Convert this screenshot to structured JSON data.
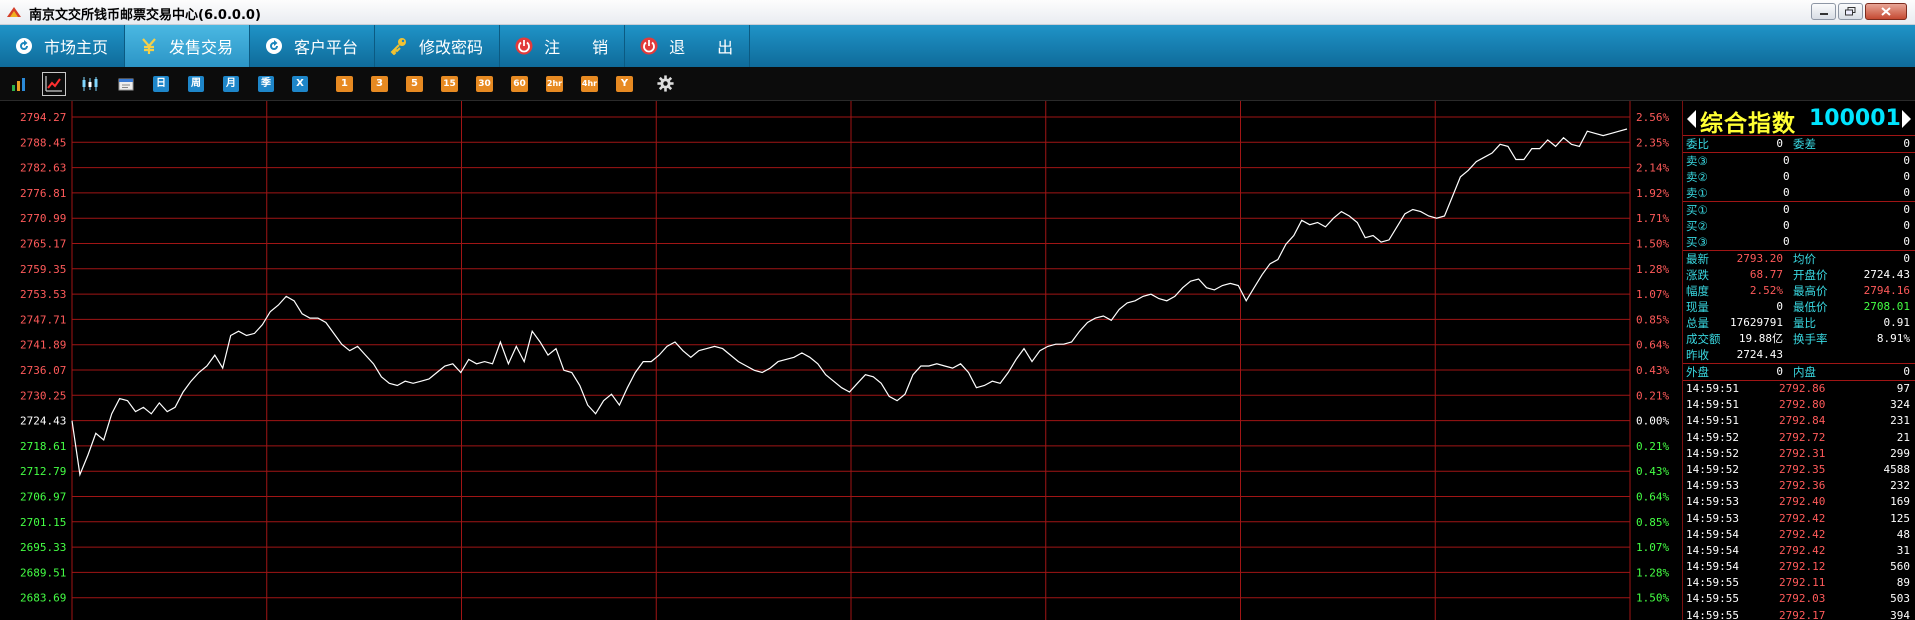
{
  "window": {
    "title": "南京文交所钱币邮票交易中心(6.0.0.0)"
  },
  "menu": [
    {
      "label": "市场主页",
      "icon": "refresh-icon",
      "active": false
    },
    {
      "label": "发售交易",
      "icon": "yen-icon",
      "active": true
    },
    {
      "label": "客户平台",
      "icon": "refresh-icon",
      "active": false
    },
    {
      "label": "修改密码",
      "icon": "key-icon",
      "active": false
    },
    {
      "label": "注　　销",
      "icon": "power-icon",
      "active": false
    },
    {
      "label": "退　　出",
      "icon": "power-icon",
      "active": false
    }
  ],
  "toolbar": {
    "blue_buttons": [
      "日",
      "周",
      "月",
      "季",
      "X"
    ],
    "orange_buttons": [
      "1",
      "3",
      "5",
      "15",
      "30",
      "60",
      "2hr",
      "4hr",
      "Y"
    ]
  },
  "chart_data": {
    "type": "line",
    "y_left_ticks": [
      "2794.27",
      "2788.45",
      "2782.63",
      "2776.81",
      "2770.99",
      "2765.17",
      "2759.35",
      "2753.53",
      "2747.71",
      "2741.89",
      "2736.07",
      "2730.25",
      "2724.43",
      "2718.61",
      "2712.79",
      "2706.97",
      "2701.15",
      "2695.33",
      "2689.51",
      "2683.69"
    ],
    "y_right_ticks": [
      "2.56%",
      "2.35%",
      "2.14%",
      "1.92%",
      "1.71%",
      "1.50%",
      "1.28%",
      "1.07%",
      "0.85%",
      "0.64%",
      "0.43%",
      "0.21%",
      "0.00%",
      "0.21%",
      "0.43%",
      "0.64%",
      "0.85%",
      "1.07%",
      "1.28%",
      "1.50%"
    ],
    "ylim": [
      2683.69,
      2794.27
    ],
    "base": 2724.43,
    "colors": {
      "up": "#ff5a5a",
      "down": "#44ff44",
      "flat": "#ffffff",
      "grid": "#a01515",
      "line": "#ffffff"
    },
    "series": [
      {
        "values": [
          2724.4,
          2712.0,
          2716.5,
          2721.5,
          2720.0,
          2726.0,
          2729.5,
          2729.0,
          2726.5,
          2727.5,
          2726.0,
          2728.5,
          2726.5,
          2727.5,
          2731.0,
          2733.5,
          2735.5,
          2737.0,
          2739.5,
          2736.5,
          2744.0,
          2745.0,
          2744.0,
          2744.5,
          2746.5,
          2749.5,
          2751.0,
          2753.0,
          2752.0,
          2749.0,
          2748.0,
          2748.0,
          2747.0,
          2744.5,
          2742.0,
          2740.5,
          2741.5,
          2739.5,
          2737.5,
          2734.5,
          2733.0,
          2732.5,
          2733.5,
          2733.0,
          2733.5,
          2734.0,
          2735.5,
          2737.0,
          2737.5,
          2735.5,
          2738.5,
          2737.5,
          2738.0,
          2737.5,
          2742.5,
          2737.5,
          2741.5,
          2738.0,
          2745.0,
          2742.5,
          2739.5,
          2741.0,
          2736.0,
          2735.5,
          2732.5,
          2728.0,
          2726.0,
          2729.0,
          2730.5,
          2728.0,
          2732.0,
          2735.5,
          2738.0,
          2738.0,
          2739.5,
          2741.5,
          2742.5,
          2740.5,
          2739.0,
          2740.5,
          2741.0,
          2741.5,
          2741.0,
          2739.5,
          2738.0,
          2737.0,
          2736.0,
          2735.5,
          2736.5,
          2738.0,
          2738.5,
          2739.0,
          2740.0,
          2739.0,
          2737.5,
          2735.0,
          2733.5,
          2732.0,
          2731.0,
          2733.0,
          2735.0,
          2734.5,
          2733.0,
          2730.0,
          2729.0,
          2730.5,
          2735.0,
          2737.0,
          2737.0,
          2737.5,
          2737.0,
          2736.5,
          2737.5,
          2735.5,
          2732.0,
          2732.5,
          2733.5,
          2733.0,
          2735.5,
          2738.5,
          2741.0,
          2738.0,
          2740.5,
          2741.5,
          2742.0,
          2742.0,
          2742.5,
          2745.0,
          2747.0,
          2748.0,
          2748.5,
          2747.5,
          2750.0,
          2751.5,
          2752.0,
          2753.0,
          2753.5,
          2752.5,
          2752.0,
          2753.0,
          2755.0,
          2756.5,
          2757.0,
          2755.0,
          2754.5,
          2755.5,
          2756.0,
          2755.5,
          2752.0,
          2755.0,
          2758.0,
          2760.5,
          2761.5,
          2765.0,
          2767.0,
          2770.5,
          2769.5,
          2770.0,
          2769.0,
          2771.0,
          2772.5,
          2771.5,
          2770.0,
          2766.5,
          2767.0,
          2765.5,
          2766.0,
          2769.0,
          2772.0,
          2773.0,
          2772.5,
          2771.5,
          2771.0,
          2771.5,
          2776.0,
          2780.5,
          2782.0,
          2784.0,
          2785.0,
          2786.0,
          2788.0,
          2787.5,
          2784.5,
          2784.5,
          2787.0,
          2787.0,
          2789.0,
          2787.5,
          2789.5,
          2788.0,
          2787.5,
          2791.0,
          2790.5,
          2790.0,
          2790.5,
          2791.0,
          2791.5
        ]
      }
    ]
  },
  "quote": {
    "name": "综合指数",
    "code": "100001",
    "top": [
      {
        "label": "委比",
        "value": "0",
        "label2": "委差",
        "value2": "0"
      }
    ],
    "sell": [
      {
        "label": "卖③",
        "price": "0",
        "vol": "0"
      },
      {
        "label": "卖②",
        "price": "0",
        "vol": "0"
      },
      {
        "label": "卖①",
        "price": "0",
        "vol": "0"
      }
    ],
    "buy": [
      {
        "label": "买①",
        "price": "0",
        "vol": "0"
      },
      {
        "label": "买②",
        "price": "0",
        "vol": "0"
      },
      {
        "label": "买③",
        "price": "0",
        "vol": "0"
      }
    ],
    "stats": [
      {
        "label": "最新",
        "value": "2793.20",
        "c1": "red",
        "label2": "均价",
        "value2": "0",
        "c2": "white"
      },
      {
        "label": "涨跌",
        "value": "68.77",
        "c1": "red",
        "label2": "开盘价",
        "value2": "2724.43",
        "c2": "white"
      },
      {
        "label": "幅度",
        "value": "2.52%",
        "c1": "red",
        "label2": "最高价",
        "value2": "2794.16",
        "c2": "red"
      },
      {
        "label": "现量",
        "value": "0",
        "c1": "white",
        "label2": "最低价",
        "value2": "2708.01",
        "c2": "green"
      },
      {
        "label": "总量",
        "value": "17629791",
        "c1": "white",
        "label2": "量比",
        "value2": "0.91",
        "c2": "white"
      },
      {
        "label": "成交额",
        "value": "19.88亿",
        "c1": "white",
        "label2": "换手率",
        "value2": "8.91%",
        "c2": "white"
      },
      {
        "label": "昨收",
        "value": "2724.43",
        "c1": "white",
        "label2": "",
        "value2": "",
        "c2": "white"
      }
    ],
    "inout": {
      "label": "外盘",
      "value": "0",
      "label2": "内盘",
      "value2": "0"
    },
    "ticks": [
      {
        "time": "14:59:51",
        "price": "2792.86",
        "vol": "97",
        "vc": "white"
      },
      {
        "time": "14:59:51",
        "price": "2792.80",
        "vol": "324",
        "vc": "white"
      },
      {
        "time": "14:59:51",
        "price": "2792.84",
        "vol": "231",
        "vc": "white"
      },
      {
        "time": "14:59:52",
        "price": "2792.72",
        "vol": "21",
        "vc": "white"
      },
      {
        "time": "14:59:52",
        "price": "2792.31",
        "vol": "299",
        "vc": "white"
      },
      {
        "time": "14:59:52",
        "price": "2792.35",
        "vol": "4588",
        "vc": "yellow"
      },
      {
        "time": "14:59:53",
        "price": "2792.36",
        "vol": "232",
        "vc": "white"
      },
      {
        "time": "14:59:53",
        "price": "2792.40",
        "vol": "169",
        "vc": "white"
      },
      {
        "time": "14:59:53",
        "price": "2792.42",
        "vol": "125",
        "vc": "white"
      },
      {
        "time": "14:59:54",
        "price": "2792.42",
        "vol": "48",
        "vc": "white"
      },
      {
        "time": "14:59:54",
        "price": "2792.42",
        "vol": "31",
        "vc": "white"
      },
      {
        "time": "14:59:54",
        "price": "2792.12",
        "vol": "560",
        "vc": "white"
      },
      {
        "time": "14:59:55",
        "price": "2792.11",
        "vol": "89",
        "vc": "white"
      },
      {
        "time": "14:59:55",
        "price": "2792.03",
        "vol": "503",
        "vc": "white"
      },
      {
        "time": "14:59:55",
        "price": "2792.17",
        "vol": "394",
        "vc": "white"
      }
    ]
  }
}
